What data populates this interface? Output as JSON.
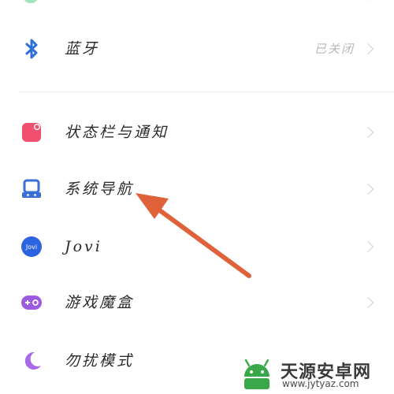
{
  "settings": {
    "items": [
      {
        "label": "蓝牙",
        "value": "已关闭",
        "icon": "bluetooth-icon"
      },
      {
        "label": "状态栏与通知",
        "icon": "status-bar-icon"
      },
      {
        "label": "系统导航",
        "icon": "navigation-icon"
      },
      {
        "label": "Jovi",
        "icon": "jovi-icon",
        "icon_text": "Jovi"
      },
      {
        "label": "游戏魔盒",
        "icon": "game-box-icon"
      },
      {
        "label": "勿扰模式",
        "icon": "moon-icon"
      }
    ]
  },
  "annotation": {
    "arrow_color": "#e0623a",
    "points_to": "系统导航"
  },
  "watermark": {
    "title": "天源安卓网",
    "url": "www.jytyaz.com"
  },
  "colors": {
    "bluetooth": "#2f6fd8",
    "status_bar": "#f0506e",
    "navigation": "#3b6ed6",
    "jovi": "#2b63e0",
    "game_box": "#9b5be0",
    "moon": "#a86ae8"
  }
}
